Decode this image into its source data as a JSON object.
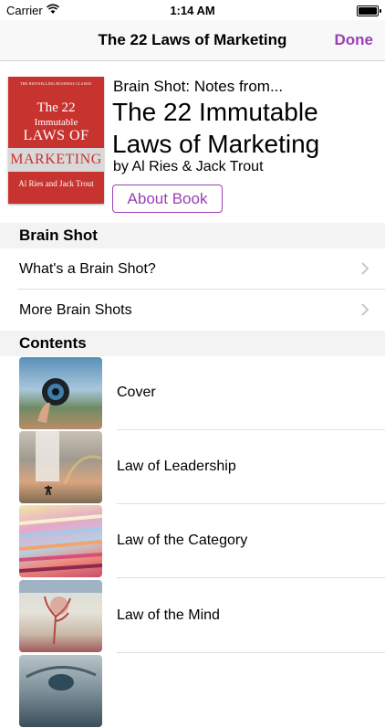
{
  "status_bar": {
    "carrier": "Carrier",
    "time": "1:14 AM",
    "wifi_icon": "wifi-icon",
    "battery_icon": "battery-icon"
  },
  "navbar": {
    "title": "The 22 Laws of Marketing",
    "done_label": "Done",
    "accent_color": "#9b3fb5"
  },
  "book": {
    "cover": {
      "tagline": "THE BESTSELLING BUSINESS CLASSIC",
      "line1": "The 22",
      "line2": "Immutable",
      "line3": "LAWS OF",
      "band": "MARKETING",
      "authors": "Al Ries and Jack Trout"
    },
    "subtitle": "Brain Shot: Notes from...",
    "title": "The 22 Immutable Laws of Marketing",
    "author": "by Al Ries & Jack Trout",
    "about_button": "About Book"
  },
  "brain_shot_section": {
    "header": "Brain Shot",
    "items": [
      {
        "label": "What's a Brain Shot?",
        "icon": "chevron-right-icon"
      },
      {
        "label": "More Brain Shots",
        "icon": "chevron-right-icon"
      }
    ]
  },
  "contents_section": {
    "header": "Contents",
    "items": [
      {
        "label": "Cover",
        "thumb": "lens-photo"
      },
      {
        "label": "Law of Leadership",
        "thumb": "waterfall-photo"
      },
      {
        "label": "Law of the Category",
        "thumb": "paper-stack-photo"
      },
      {
        "label": "Law of the Mind",
        "thumb": "sculpture-photo"
      },
      {
        "label": "",
        "thumb": "eye-photo"
      }
    ]
  }
}
